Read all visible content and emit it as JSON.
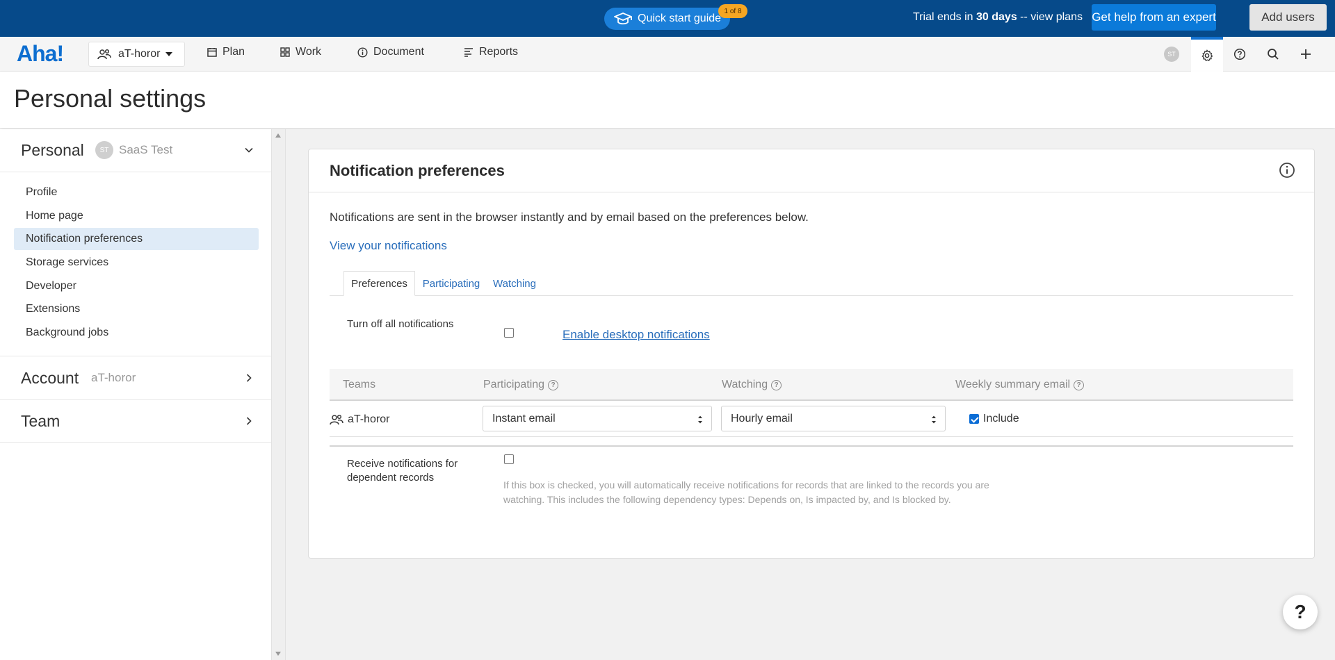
{
  "banner": {
    "quick_start_label": "Quick start guide",
    "quick_start_badge": "1 of 8",
    "trial_prefix": "Trial ends in ",
    "trial_days": "30 days",
    "trial_suffix": " -- view plans",
    "expert_button": "Get help from an expert",
    "add_users_button": "Add users"
  },
  "navbar": {
    "logo": "Aha!",
    "workspace": "aT-horor",
    "items": [
      "Plan",
      "Work",
      "Document",
      "Reports"
    ],
    "avatar_initials": "ST"
  },
  "page": {
    "title": "Personal settings"
  },
  "sidebar": {
    "personal": {
      "title": "Personal",
      "avatar": "ST",
      "subtitle": "SaaS Test"
    },
    "items": [
      {
        "label": "Profile",
        "selected": false
      },
      {
        "label": "Home page",
        "selected": false
      },
      {
        "label": "Notification preferences",
        "selected": true
      },
      {
        "label": "Storage services",
        "selected": false
      },
      {
        "label": "Developer",
        "selected": false
      },
      {
        "label": "Extensions",
        "selected": false
      },
      {
        "label": "Background jobs",
        "selected": false
      }
    ],
    "account": {
      "title": "Account",
      "subtitle": "aT-horor"
    },
    "team": {
      "title": "Team"
    }
  },
  "card": {
    "title": "Notification preferences",
    "description": "Notifications are sent in the browser instantly and by email based on the preferences below.",
    "view_link": "View your notifications",
    "tabs": [
      {
        "label": "Preferences",
        "active": true
      },
      {
        "label": "Participating",
        "active": false
      },
      {
        "label": "Watching",
        "active": false
      }
    ],
    "turn_off_label": "Turn off all notifications",
    "turn_off_checked": false,
    "desktop_link": "Enable desktop notifications",
    "table": {
      "headers": [
        "Teams",
        "Participating",
        "Watching",
        "Weekly summary email"
      ],
      "rows": [
        {
          "team": "aT-horor",
          "participating": "Instant email",
          "watching": "Hourly email",
          "weekly_checked": true,
          "weekly_label": "Include"
        }
      ]
    },
    "dependent_label": "Receive notifications for dependent records",
    "dependent_checked": false,
    "dependent_help": "If this box is checked, you will automatically receive notifications for records that are linked to the records you are watching. This includes the following dependency types: Depends on, Is impacted by, and Is blocked by."
  },
  "help_button": "?"
}
